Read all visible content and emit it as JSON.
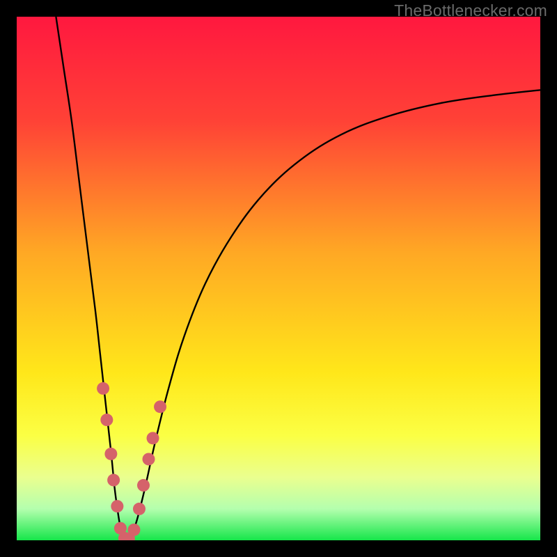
{
  "watermark": "TheBottlenecker.com",
  "chart_data": {
    "type": "line",
    "title": "",
    "xlabel": "",
    "ylabel": "",
    "xlim": [
      0,
      100
    ],
    "ylim": [
      0,
      100
    ],
    "gradient_stops": [
      {
        "offset": 0,
        "color": "#ff183f"
      },
      {
        "offset": 20,
        "color": "#ff4236"
      },
      {
        "offset": 45,
        "color": "#ffa824"
      },
      {
        "offset": 68,
        "color": "#ffe71a"
      },
      {
        "offset": 80,
        "color": "#fbff44"
      },
      {
        "offset": 88,
        "color": "#eaff8f"
      },
      {
        "offset": 94,
        "color": "#b4ffae"
      },
      {
        "offset": 100,
        "color": "#16e64a"
      }
    ],
    "series": [
      {
        "name": "left-branch",
        "x": [
          7.5,
          9,
          10.5,
          12,
          13.5,
          15,
          16,
          17,
          18,
          18.7,
          19.3,
          19.8,
          20.3
        ],
        "y": [
          100,
          90,
          80,
          68,
          56,
          44,
          35,
          26,
          17,
          10,
          5.5,
          2.5,
          0.5
        ]
      },
      {
        "name": "right-branch",
        "x": [
          21.8,
          23,
          24.5,
          26.5,
          29,
          32,
          36,
          41,
          47,
          54,
          62,
          71,
          81,
          91,
          100
        ],
        "y": [
          0.5,
          4,
          10,
          19,
          29,
          39,
          49,
          58,
          66,
          72.5,
          77.5,
          81,
          83.5,
          85,
          86
        ]
      },
      {
        "name": "valley-floor",
        "x": [
          20.3,
          21,
          21.8
        ],
        "y": [
          0.5,
          0,
          0.5
        ]
      }
    ],
    "markers": {
      "color": "#d5626a",
      "radius_px": 9,
      "points": [
        {
          "x": 16.5,
          "y": 29
        },
        {
          "x": 17.2,
          "y": 23
        },
        {
          "x": 18.0,
          "y": 16.5
        },
        {
          "x": 18.5,
          "y": 11.5
        },
        {
          "x": 19.2,
          "y": 6.5
        },
        {
          "x": 19.8,
          "y": 2.3
        },
        {
          "x": 20.6,
          "y": 0.4
        },
        {
          "x": 21.4,
          "y": 0.3
        },
        {
          "x": 22.4,
          "y": 2.0
        },
        {
          "x": 23.4,
          "y": 6.0
        },
        {
          "x": 24.2,
          "y": 10.5
        },
        {
          "x": 25.2,
          "y": 15.5
        },
        {
          "x": 26.0,
          "y": 19.5
        },
        {
          "x": 27.4,
          "y": 25.5
        }
      ]
    }
  }
}
